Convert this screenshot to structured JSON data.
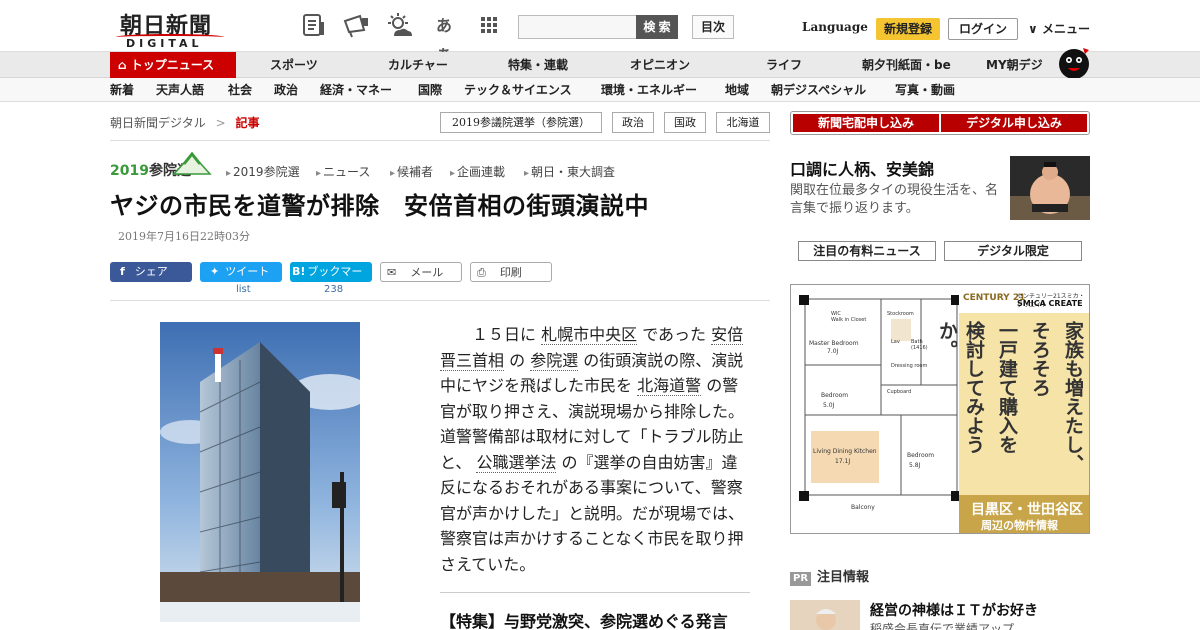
{
  "header": {
    "logo_main": "朝日新聞",
    "logo_sub": "DIGITAL",
    "icons": [
      "newspaper-icon",
      "megaphone-icon",
      "weather-icon",
      "font-size-icon",
      "grid-icon"
    ],
    "font_icon_text": "あぁ",
    "search": {
      "placeholder": "",
      "button": "検 索"
    },
    "toc_button": "目次",
    "language": "Language",
    "signup": "新規登録",
    "login": "ログイン",
    "menu": "メニュー"
  },
  "nav_primary": [
    "トップニュース",
    "スポーツ",
    "カルチャー",
    "特集・連載",
    "オピニオン",
    "ライフ",
    "朝夕刊紙面・be",
    "MY朝デジ"
  ],
  "nav_secondary": [
    "新着",
    "天声人語",
    "社会",
    "政治",
    "経済・マネー",
    "国際",
    "テック＆サイエンス",
    "環境・エネルギー",
    "地域",
    "朝デジスペシャル",
    "写真・動画"
  ],
  "breadcrumb": {
    "home": "朝日新聞デジタル",
    "sep": ">",
    "current": "記事"
  },
  "tags": [
    "2019参議院選挙（参院選）",
    "政治",
    "国政",
    "北海道"
  ],
  "subscribe": {
    "delivery": "新聞宅配申し込み",
    "digital": "デジタル申し込み"
  },
  "series": {
    "year": "2019",
    "name": "参院選"
  },
  "series_links": [
    "2019参院選",
    "ニュース",
    "候補者",
    "企画連載",
    "朝日・東大調査"
  ],
  "article": {
    "headline": "ヤジの市民を道警が排除　安倍首相の街頭演説中",
    "date": "2019年7月16日22時03分",
    "share": {
      "facebook": "シェア",
      "twitter": "ツイート",
      "twitter_count": "list",
      "hatena": "ブックマーク",
      "hatena_count": "238",
      "mail": "メール",
      "print": "印刷"
    },
    "body": [
      {
        "t": "　１５日に "
      },
      {
        "a": "札幌市中央区"
      },
      {
        "t": " であった "
      },
      {
        "a": "安倍晋三首相"
      },
      {
        "t": " の "
      },
      {
        "a": "参院選"
      },
      {
        "t": " の街頭演説の際、演説中にヤジを飛ばした市民を "
      },
      {
        "a": "北海道警"
      },
      {
        "t": " の警官が取り押さえ、演説現場から排除した。道警警備部は取材に対して「トラブル防止と、 "
      },
      {
        "a": "公職選挙法"
      },
      {
        "t": " の『選挙の自由妨害』違反になるおそれがある事案について、警察官が声かけした」と説明。だが現場では、警察官は声かけすることなく市民を取り押さえていた。"
      }
    ],
    "special_link": "【特集】与野党激突、参院選めぐる発言"
  },
  "sidebar": {
    "feature_title": "口調に人柄、安美錦",
    "feature_desc": "関取在位最多タイの現役生活を、名言集で振り返ります。",
    "tabs": [
      "注目の有料ニュース",
      "デジタル限定"
    ],
    "ad": {
      "brand": "CENTURY 21",
      "company_jp": "センチュリー21スミカ・クリエイト",
      "company_en": "SMICA CREATE",
      "copy_lines": [
        "家族も増えたし、",
        "そろそろ",
        "一戸建て購入を",
        "検討してみようか。"
      ],
      "area": "目黒区・世田谷区",
      "area_sub": "周辺の物件情報",
      "floorplan_labels": [
        "WIC",
        "Walk in Closet",
        "Stockroom",
        "Master Bedroom",
        "7.0J",
        "Lav",
        "Bath",
        "(1416)",
        "Dressing room",
        "Cupboard",
        "Bedroom",
        "5.0J",
        "Living Dining Kitchen",
        "17.1J",
        "Bedroom",
        "5.8J",
        "Balcony"
      ]
    },
    "pr_label": "PR",
    "pr_heading": "注目情報",
    "pr_title": "経営の神様はＩＴがお好き",
    "pr_sub": "稲盛会長直伝で業績アップ"
  },
  "colors": {
    "brand_red": "#cc0000",
    "subscribe_red": "#b90000",
    "signup_yellow": "#f4c531",
    "series_green": "#3a9a3a",
    "facebook": "#3b5998",
    "twitter": "#1da1f2",
    "hatena": "#00a4de"
  }
}
